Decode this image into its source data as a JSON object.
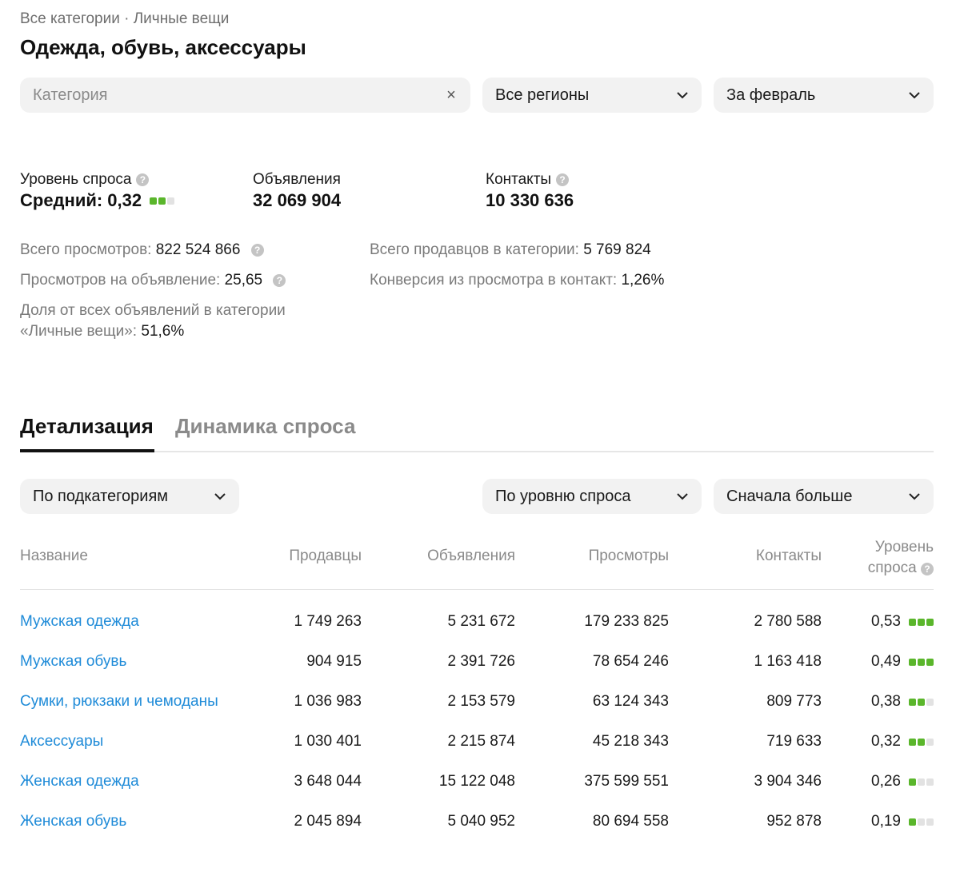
{
  "breadcrumb": "Все категории · Личные вещи",
  "title": "Одежда, обувь, аксессуары",
  "filters": {
    "category_placeholder": "Категория",
    "region": "Все регионы",
    "period": "За февраль"
  },
  "kpis": {
    "demand_label": "Уровень спроса",
    "demand_value": "Средний: 0,32",
    "demand_level": 2,
    "ads_label": "Объявления",
    "ads_value": "32 069 904",
    "contacts_label": "Контакты",
    "contacts_value": "10 330 636"
  },
  "stats": {
    "views_label": "Всего просмотров:",
    "views_value": "822 524 866",
    "views_per_ad_label": "Просмотров на объявление:",
    "views_per_ad_value": "25,65",
    "share_label_line1": "Доля от всех объявлений в категории",
    "share_label_line2": "«Личные вещи»:",
    "share_value": "51,6%",
    "sellers_label": "Всего продавцов в категории:",
    "sellers_value": "5 769 824",
    "conversion_label": "Конверсия из просмотра в контакт:",
    "conversion_value": "1,26%"
  },
  "tabs": {
    "detail": "Детализация",
    "dynamics": "Динамика спроса"
  },
  "table_controls": {
    "grouping": "По подкатегориям",
    "sort_by": "По уровню спроса",
    "order": "Сначала больше"
  },
  "table": {
    "headers": {
      "name": "Название",
      "sellers": "Продавцы",
      "ads": "Объявления",
      "views": "Просмотры",
      "contacts": "Контакты",
      "demand_line1": "Уровень",
      "demand_line2": "спроса"
    },
    "rows": [
      {
        "name": "Мужская одежда",
        "sellers": "1 749 263",
        "ads": "5 231 672",
        "views": "179 233 825",
        "contacts": "2 780 588",
        "demand": "0,53",
        "level": 3
      },
      {
        "name": "Мужская обувь",
        "sellers": "904 915",
        "ads": "2 391 726",
        "views": "78 654 246",
        "contacts": "1 163 418",
        "demand": "0,49",
        "level": 3
      },
      {
        "name": "Сумки, рюкзаки и чемоданы",
        "sellers": "1 036 983",
        "ads": "2 153 579",
        "views": "63 124 343",
        "contacts": "809 773",
        "demand": "0,38",
        "level": 2
      },
      {
        "name": "Аксессуары",
        "sellers": "1 030 401",
        "ads": "2 215 874",
        "views": "45 218 343",
        "contacts": "719 633",
        "demand": "0,32",
        "level": 2
      },
      {
        "name": "Женская одежда",
        "sellers": "3 648 044",
        "ads": "15 122 048",
        "views": "375 599 551",
        "contacts": "3 904 346",
        "demand": "0,26",
        "level": 1
      },
      {
        "name": "Женская обувь",
        "sellers": "2 045 894",
        "ads": "5 040 952",
        "views": "80 694 558",
        "contacts": "952 878",
        "demand": "0,19",
        "level": 1
      }
    ]
  },
  "colors": {
    "accent_link": "#1f8bd8",
    "demand_on": "#5ab62b",
    "demand_off": "#e2e2e2"
  }
}
